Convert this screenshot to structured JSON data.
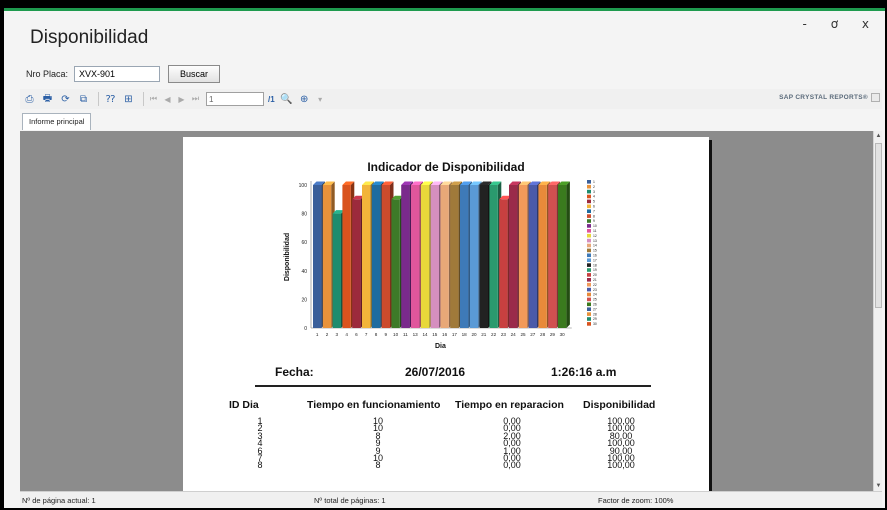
{
  "window": {
    "title": "Disponibilidad",
    "controls": [
      "-",
      "ơ",
      "x"
    ]
  },
  "search": {
    "label": "Nro Placa:",
    "value": "XVX-901",
    "button_label": "Buscar"
  },
  "toolbar": {
    "page_value": "1",
    "page_total": "/1",
    "brand": "SAP CRYSTAL REPORTS®"
  },
  "tabs": [
    {
      "label": "Informe principal"
    }
  ],
  "report": {
    "fecha_label": "Fecha:",
    "fecha_value": "26/07/2016",
    "hora_value": "1:26:16 a.m",
    "table_headers": [
      "ID Dia",
      "Tiempo en funcionamiento",
      "Tiempo en reparacion",
      "Disponibilidad"
    ],
    "table_rows": [
      [
        "1",
        "10",
        "0,00",
        "100,00"
      ],
      [
        "2",
        "10",
        "0,00",
        "100,00"
      ],
      [
        "3",
        "8",
        "2,00",
        "80,00"
      ],
      [
        "4",
        "9",
        "0,00",
        "100,00"
      ],
      [
        "6",
        "9",
        "1,00",
        "90,00"
      ],
      [
        "7",
        "10",
        "0,00",
        "100,00"
      ],
      [
        "8",
        "8",
        "0,00",
        "100,00"
      ]
    ]
  },
  "chart_data": {
    "type": "bar",
    "title": "Indicador de Disponibilidad",
    "xlabel": "Dia",
    "ylabel": "Disponibilidad",
    "ylim": [
      0,
      100
    ],
    "yticks": [
      0,
      20,
      40,
      60,
      80,
      100
    ],
    "categories": [
      "1",
      "2",
      "3",
      "4",
      "6",
      "7",
      "8",
      "9",
      "10",
      "11",
      "13",
      "14",
      "15",
      "16",
      "17",
      "18",
      "20",
      "21",
      "22",
      "23",
      "24",
      "25",
      "27",
      "28",
      "29",
      "30"
    ],
    "values": [
      100,
      100,
      80,
      100,
      90,
      100,
      100,
      100,
      90,
      100,
      100,
      100,
      100,
      100,
      100,
      100,
      100,
      100,
      100,
      90,
      100,
      100,
      100,
      100,
      100,
      100
    ],
    "colors": [
      "#3a5f9a",
      "#e8923a",
      "#1e8c6e",
      "#d9531e",
      "#9c2a3c",
      "#f2b43a",
      "#1e6ca0",
      "#cc4b2c",
      "#3d7a28",
      "#7a2a8c",
      "#e0569c",
      "#e8d83a",
      "#d58fbf",
      "#e8a878",
      "#a07a3a",
      "#3e7ab8",
      "#5a9ad6",
      "#222222",
      "#2a9a6e",
      "#c84040",
      "#9a2a4a",
      "#f29a5a",
      "#4a5aa8",
      "#e88a3a",
      "#d05050",
      "#3a7a1e"
    ],
    "legend": [
      "1",
      "2",
      "3",
      "4",
      "5",
      "6",
      "7",
      "8",
      "9",
      "10",
      "11",
      "12",
      "13",
      "14",
      "15",
      "16",
      "17",
      "18",
      "19",
      "20",
      "21",
      "22",
      "23",
      "24",
      "25",
      "26",
      "27",
      "28",
      "29",
      "30"
    ],
    "legend_position": "right",
    "grid": false
  },
  "status": {
    "current_page": "Nº de página actual: 1",
    "total_pages": "Nº total de páginas: 1",
    "zoom": "Factor de zoom: 100%"
  }
}
